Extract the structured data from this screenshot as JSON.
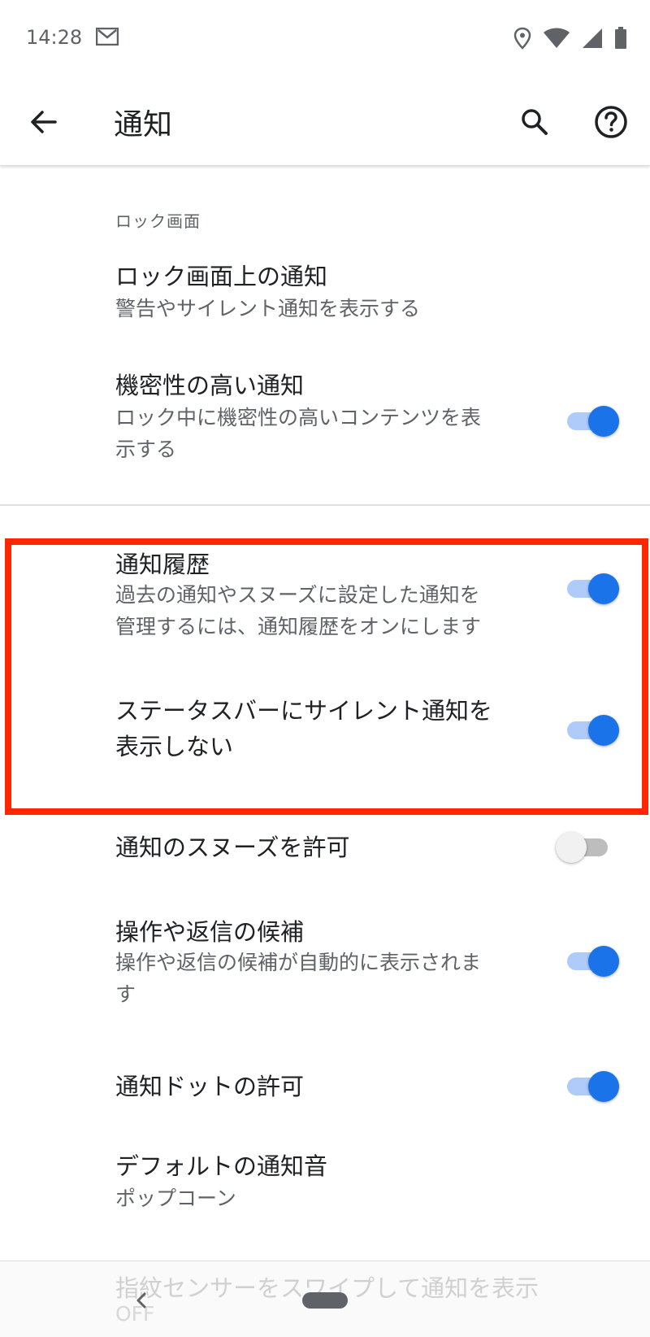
{
  "status_bar": {
    "time": "14:28",
    "icons": [
      "gmail-icon",
      "location-icon",
      "wifi-icon",
      "signal-icon",
      "battery-icon"
    ]
  },
  "toolbar": {
    "title": "通知",
    "icons": [
      "back-arrow-icon",
      "search-icon",
      "help-icon"
    ]
  },
  "section": {
    "lock_screen_header": "ロック画面"
  },
  "items": {
    "lock_screen_notifications": {
      "title": "ロック画面上の通知",
      "summary": "警告やサイレント通知を表示する"
    },
    "sensitive_notifications": {
      "title": "機密性の高い通知",
      "summary_line1": "ロック中に機密性の高いコンテンツを表",
      "summary_line2": "示する",
      "toggle": true
    },
    "notification_history": {
      "title": "通知履歴",
      "summary_line1": "過去の通知やスヌーズに設定した通知を",
      "summary_line2": "管理するには、通知履歴をオンにします",
      "toggle": true
    },
    "hide_silent_status_bar": {
      "title_line1": "ステータスバーにサイレント通知を",
      "title_line2": "表示しない",
      "toggle": true
    },
    "allow_snooze": {
      "title": "通知のスヌーズを許可",
      "toggle": false
    },
    "suggested_actions": {
      "title": "操作や返信の候補",
      "summary_line1": "操作や返信の候補が自動的に表示されま",
      "summary_line2": "す",
      "toggle": true
    },
    "notification_dot": {
      "title": "通知ドットの許可",
      "toggle": true
    },
    "default_sound": {
      "title": "デフォルトの通知音",
      "summary": "ポップコーン"
    },
    "fingerprint_swipe": {
      "title": "指紋センサーをスワイプして通知を表示",
      "summary": "OFF"
    }
  },
  "colors": {
    "accent": "#1a73e8",
    "accent_track": "#aecbfa",
    "highlight_border": "#ff2600"
  }
}
